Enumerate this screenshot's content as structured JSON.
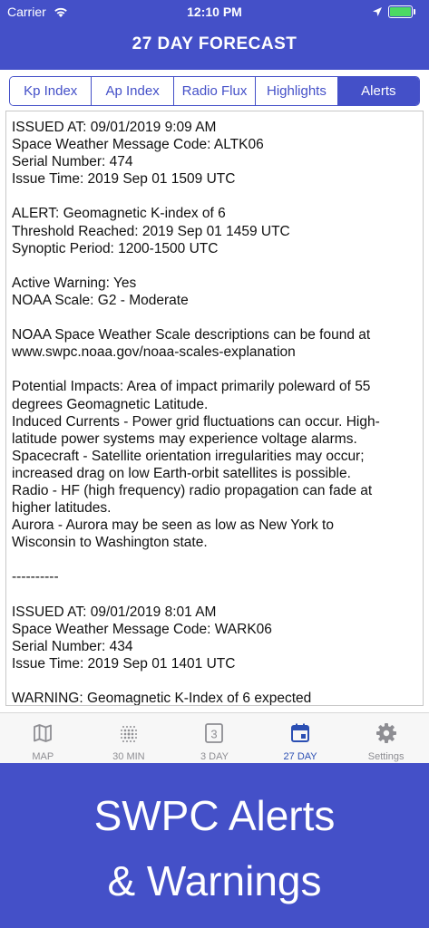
{
  "status": {
    "carrier": "Carrier",
    "time": "12:10 PM"
  },
  "header": {
    "title": "27 DAY FORECAST"
  },
  "tabs": [
    {
      "label": "Kp Index",
      "active": false
    },
    {
      "label": "Ap Index",
      "active": false
    },
    {
      "label": "Radio Flux",
      "active": false
    },
    {
      "label": "Highlights",
      "active": false
    },
    {
      "label": "Alerts",
      "active": true
    }
  ],
  "alerts_text": [
    "ISSUED AT: 09/01/2019 9:09 AM",
    "Space Weather Message Code: ALTK06",
    "Serial Number: 474",
    "Issue Time: 2019 Sep 01 1509 UTC",
    "",
    "ALERT: Geomagnetic K-index of 6",
    "Threshold Reached: 2019 Sep 01 1459 UTC",
    "Synoptic Period: 1200-1500 UTC",
    "",
    "Active Warning: Yes",
    "NOAA Scale: G2 - Moderate",
    "",
    "NOAA Space Weather Scale descriptions can be found at",
    "www.swpc.noaa.gov/noaa-scales-explanation",
    "",
    "Potential Impacts: Area of impact primarily poleward of 55",
    "degrees Geomagnetic Latitude.",
    "Induced Currents - Power grid fluctuations can occur. High-",
    "latitude power systems may experience voltage alarms.",
    "Spacecraft - Satellite orientation irregularities may occur;",
    "increased drag on low Earth-orbit satellites is possible.",
    "Radio - HF (high frequency) radio propagation can fade at",
    "higher latitudes.",
    "Aurora - Aurora may be seen as low as New York to",
    "Wisconsin to Washington state.",
    "",
    "----------",
    "",
    "ISSUED AT: 09/01/2019 8:01 AM",
    "Space Weather Message Code: WARK06",
    "Serial Number: 434",
    "Issue Time: 2019 Sep 01 1401 UTC",
    "",
    "WARNING: Geomagnetic K-Index of 6 expected"
  ],
  "tabbar": [
    {
      "label": "MAP",
      "icon": "map-icon",
      "active": false
    },
    {
      "label": "30 MIN",
      "icon": "dot-grid-icon",
      "active": false
    },
    {
      "label": "3 DAY",
      "icon": "calendar-3-icon",
      "icon_text": "3",
      "active": false
    },
    {
      "label": "27 DAY",
      "icon": "calendar-icon",
      "active": true
    },
    {
      "label": "Settings",
      "icon": "gear-icon",
      "active": false
    }
  ],
  "promo": {
    "line1": "SWPC Alerts",
    "line2": "& Warnings"
  },
  "colors": {
    "brand": "#4450c8",
    "active_tab_icon": "#2b4fb3",
    "inactive_tab_icon": "#8e8e93"
  }
}
